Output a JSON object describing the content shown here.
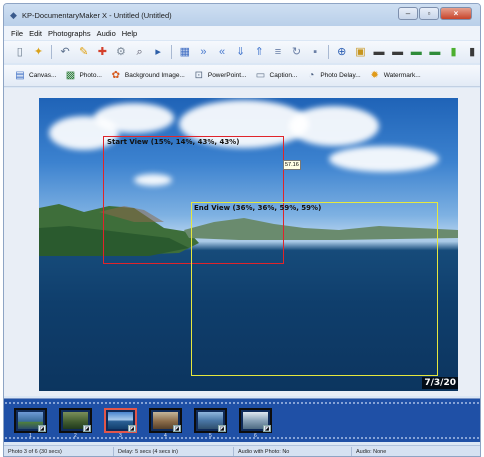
{
  "window": {
    "title": "KP-DocumentaryMaker X - Untitled (Untitled)",
    "app_icon": "app-icon",
    "controls": [
      "minimize",
      "maximize",
      "close"
    ]
  },
  "menu": {
    "items": [
      "File",
      "Edit",
      "Photographs",
      "Audio",
      "Help"
    ]
  },
  "toolbar1": {
    "icons": [
      "new-icon",
      "open-icon",
      "separator",
      "undo-icon",
      "edit-icon",
      "paint-icon",
      "settings-icon",
      "zoom-icon",
      "play-icon",
      "separator",
      "select-icon",
      "fast-forward-icon",
      "rewind-icon",
      "down-icon",
      "up-icon",
      "list-icon",
      "refresh-icon",
      "tag-icon",
      "separator",
      "move-icon",
      "image-icon",
      "film-icon",
      "film2-icon",
      "color1-icon",
      "color2-icon",
      "green-icon",
      "exit-icon"
    ]
  },
  "toolbar2": {
    "buttons": [
      {
        "label": "Canvas...",
        "icon": "canvas-icon"
      },
      {
        "label": "Photo...",
        "icon": "photo-icon"
      },
      {
        "label": "Background Image...",
        "icon": "background-image-icon"
      },
      {
        "label": "PowerPoint...",
        "icon": "powerpoint-icon"
      },
      {
        "label": "Caption...",
        "icon": "caption-icon"
      },
      {
        "label": "Photo Delay...",
        "icon": "photo-delay-icon"
      },
      {
        "label": "Watermark...",
        "icon": "watermark-icon"
      }
    ]
  },
  "preview": {
    "start_view_label": "Start View (15%, 14%, 43%, 43%)",
    "end_view_label": "End View (36%, 36%, 59%, 59%)",
    "delay_tag": "57.16",
    "date_stamp": "7/3/20"
  },
  "filmstrip": {
    "selected_index": 2,
    "thumbnails": [
      {
        "num": "1"
      },
      {
        "num": "2"
      },
      {
        "num": "3"
      },
      {
        "num": "4"
      },
      {
        "num": "5"
      },
      {
        "num": "6"
      }
    ]
  },
  "status": {
    "photo": "Photo 3 of 6 (30 secs)",
    "delay": "Delay: 5 secs (4 secs in)",
    "audio_with_photo": "Audio with Photo: No",
    "audio": "Audio: None"
  },
  "colors": {
    "start_rect": "#e0242a",
    "end_rect": "#e6e83d",
    "filmstrip": "#1f50a6"
  }
}
